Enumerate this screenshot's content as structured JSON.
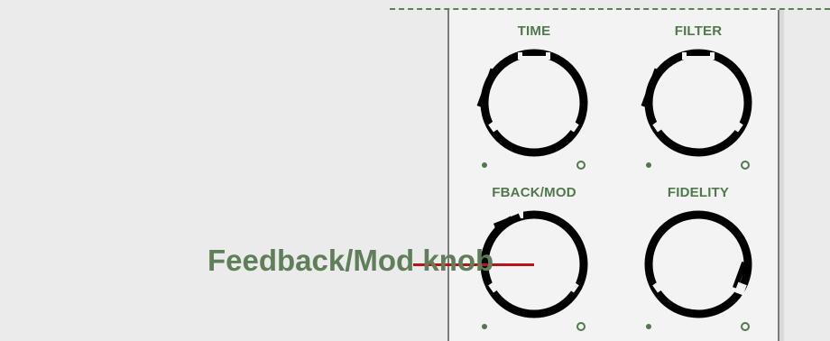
{
  "panel": {
    "knobs": [
      {
        "id": "time",
        "label": "TIME"
      },
      {
        "id": "filter",
        "label": "FILTER"
      },
      {
        "id": "fback-mod",
        "label": "FBACK/MOD"
      },
      {
        "id": "fidelity",
        "label": "FIDELITY"
      }
    ]
  },
  "callout": {
    "label": "Feedback/Mod knob"
  },
  "colors": {
    "label_green": "#4e7a49",
    "callout_green": "#5f7f58",
    "leader_red": "#b8121b",
    "knob_ring": "#000000",
    "panel_border": "#7b7b7b"
  }
}
